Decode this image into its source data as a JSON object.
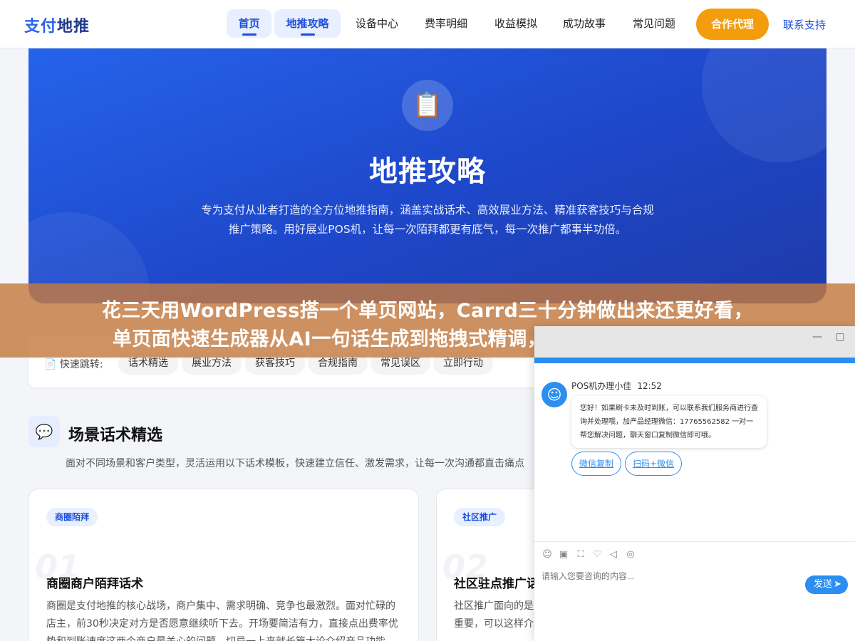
{
  "nav": {
    "logo_part1": "支付",
    "logo_part2": "地推",
    "items": [
      "首页",
      "地推攻略",
      "设备中心",
      "费率明细",
      "收益模拟",
      "成功故事",
      "常见问题"
    ],
    "cta": "合作代理",
    "support": "联系支持",
    "active_color": "#1d4ed8",
    "cta_color": "#f39c0c"
  },
  "hero": {
    "icon": "clipboard-icon",
    "title": "地推攻略",
    "description": "专为支付从业者打造的全方位地推指南，涵盖实战话术、高效展业方法、精准获客技巧与合规推广策略。用好展业POS机，让每一次陌拜都更有底气，每一次推广都事半功倍。",
    "color": "#2563eb"
  },
  "banner": {
    "line1": "花三天用WordPress搭一个单页网站，Carrd三十分钟做出来还更好看，",
    "line2": "单页面快速生成器从AI一句话生成到拖拽式精调，十款工具从免费到专业"
  },
  "quick_nav": {
    "label": "快速跳转:",
    "items": [
      "话术精选",
      "展业方法",
      "获客技巧",
      "合规指南",
      "常见误区",
      "立即行动"
    ]
  },
  "section": {
    "icon": "chat-icon",
    "title": "场景话术精选",
    "description": "面对不同场景和客户类型，灵活运用以下话术模板，快速建立信任、激发需求，让每一次沟通都直击痛点"
  },
  "cards": [
    {
      "tag": "商圈陌拜",
      "number": "01",
      "title": "商圈商户陌拜话术",
      "text": "商圈是支付地推的核心战场，商户集中、需求明确、竞争也最激烈。面对忙碌的店主，前30秒决定对方是否愿意继续听下去。开场要简洁有力，直接点出费率优势和到账速度这两个商户最关心的问题，切忌一上来就长篇大论介绍产品功能。"
    },
    {
      "tag": "社区推广",
      "number": "02",
      "title": "社区驻点推广话术",
      "text": "社区推广面向的是周边居民和小微商户，适合在社区驻点时，亲和力和信任感更重要，可以这样介绍——这台POS机安全可靠。"
    }
  ],
  "chat": {
    "agent_name": "POS机办理小佳",
    "time": "12:52",
    "message": "您好！如果刷卡未及时到账，可以联系我们服务商进行查询并处理哦，加产品经理微信：17765562582 一对一帮您解决问题，聊天窗口复制微信即可哦。",
    "button1": "微信复制",
    "button2": "扫码+微信",
    "input_placeholder": "请输入您要咨询的内容...",
    "send_label": "发送",
    "accent_color": "#2b8ef0"
  }
}
